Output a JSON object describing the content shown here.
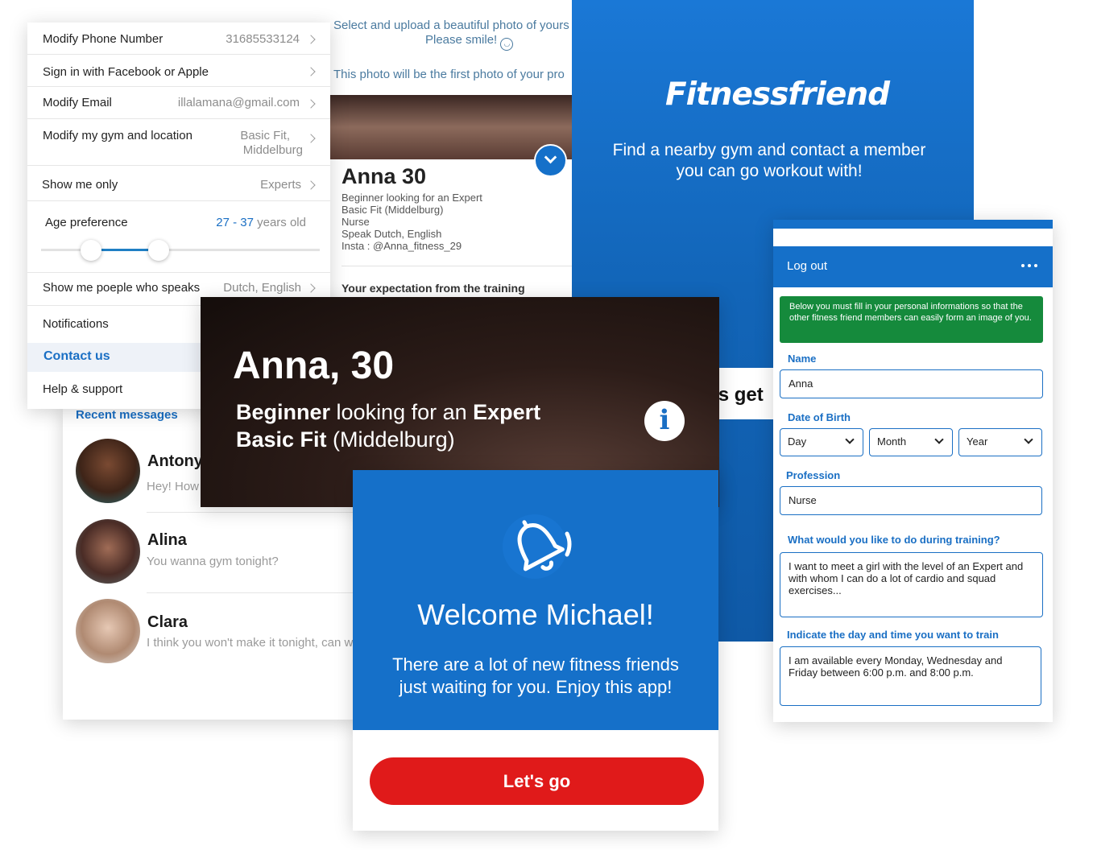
{
  "settings": {
    "rows": [
      {
        "label": "Modify Phone Number",
        "value": "31685533124"
      },
      {
        "label": "Sign in with Facebook or Apple",
        "value": ""
      },
      {
        "label": "Modify Email",
        "value": "illalamana@gmail.com"
      },
      {
        "label": "Modify my gym and location",
        "value": "Basic Fit,",
        "value2": "Middelburg"
      },
      {
        "label": "Show me only",
        "value": "Experts"
      },
      {
        "label": "Age preference",
        "age_min": "27",
        "age_sep": " - ",
        "age_max": "37",
        "age_suffix": " years old"
      },
      {
        "label": "Show me poeple who speaks",
        "value": "Dutch, English"
      },
      {
        "label": "Notifications"
      },
      {
        "label": "Contact us"
      },
      {
        "label": "Help & support"
      }
    ],
    "age_range": {
      "min_fraction": 0.18,
      "max_fraction": 0.43
    }
  },
  "messages": {
    "heading": "Recent messages",
    "items": [
      {
        "name": "Antony",
        "preview": "Hey! How"
      },
      {
        "name": "Alina",
        "preview": "You wanna gym tonight?"
      },
      {
        "name": "Clara",
        "preview": "I think you won't make it tonight, can w"
      }
    ]
  },
  "upload": {
    "line1": "Select and upload a beautiful photo of yours",
    "line2": "Please smile!",
    "line3": "This photo will be the first photo of your pro",
    "profile": {
      "name": "Anna 30",
      "lines": [
        "Beginner looking for an Expert",
        "Basic Fit (Middelburg)",
        "Nurse",
        "Speak Dutch, English",
        "Insta : @Anna_fitness_29"
      ],
      "section_title": "Your expectation from the training"
    }
  },
  "hero": {
    "logo": "Fitnessfriend",
    "tagline_line1": "Find a nearby gym and contact a member",
    "tagline_line2": "you can go workout with!",
    "get_started_partial": "'s get"
  },
  "banner": {
    "name": "Anna, 30",
    "line1_bold_a": "Beginner",
    "line1_mid": " looking for an ",
    "line1_bold_b": "Expert",
    "line2_bold": "Basic Fit",
    "line2_rest": " (Middelburg)",
    "info_glyph": "i"
  },
  "welcome": {
    "title": "Welcome Michael!",
    "text_line1": "There are a lot of new fitness friends",
    "text_line2": "just waiting for you. Enjoy this app!",
    "button": "Let's go"
  },
  "form": {
    "header": "Log out",
    "notice": "Below you must fill in your personal informations so that the other fitness friend members can easily form an image of you.",
    "name_label": "Name",
    "name_value": "Anna",
    "dob_label": "Date of Birth",
    "day": "Day",
    "month": "Month",
    "year": "Year",
    "profession_label": "Profession",
    "profession_value": "Nurse",
    "training_label": "What would you like to do during training?",
    "training_value": "I want to meet a girl with the level of an Expert and with whom I can do a lot of cardio and squad exercises...",
    "schedule_label": "Indicate the day and time you want to train",
    "schedule_value": "I am available every Monday, Wednesday and Friday between 6:00 p.m. and 8:00 p.m."
  },
  "colors": {
    "brand_blue": "#1570c9",
    "accent_blue": "#1a6fc4",
    "notice_green": "#158a3c",
    "button_red": "#e01a1a"
  }
}
